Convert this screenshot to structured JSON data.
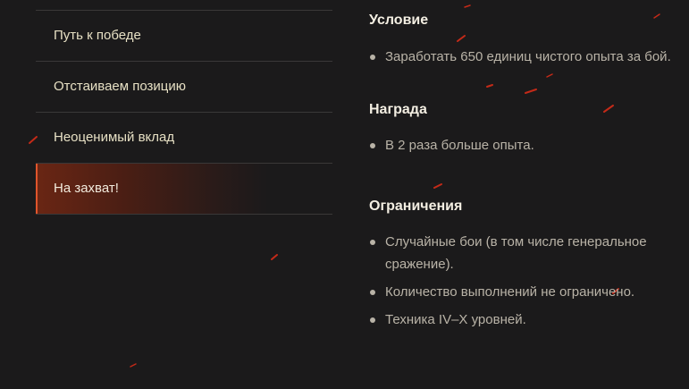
{
  "menu": {
    "items": [
      {
        "label": "Путь к победе"
      },
      {
        "label": "Отстаиваем позицию"
      },
      {
        "label": "Неоценимый вклад"
      },
      {
        "label": "На захват!"
      }
    ]
  },
  "condition": {
    "title": "Условие",
    "items": [
      "Заработать 650 единиц чистого опыта за бой."
    ]
  },
  "reward": {
    "title": "Награда",
    "items": [
      "В 2 раза больше опыта."
    ]
  },
  "restrictions": {
    "title": "Ограничения",
    "items": [
      "Случайные бои (в том числе генеральное сражение).",
      "Количество выполнений не ограничено.",
      "Техника IV–X уровней."
    ]
  },
  "colors": {
    "background": "#1b1a1b",
    "accent": "#e0552c",
    "spark": "#c22a1a"
  }
}
